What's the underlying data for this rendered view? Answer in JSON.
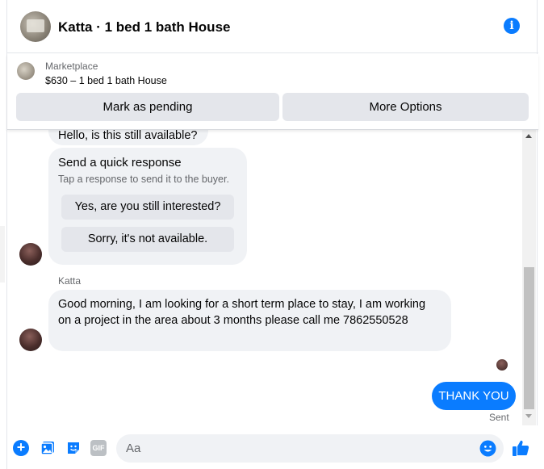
{
  "header": {
    "title": "Katta · 1 bed 1 bath House",
    "info_icon": "info-icon"
  },
  "marketplace": {
    "label": "Marketplace",
    "listing": "$630 – 1 bed 1 bath House",
    "buttons": {
      "pending": "Mark as pending",
      "more": "More Options"
    }
  },
  "messages": {
    "hello": "Hello, is this still available?",
    "quick_response": {
      "title": "Send a quick response",
      "subtitle": "Tap a response to send it to the buyer.",
      "options": [
        "Yes, are you still interested?",
        "Sorry, it's not available."
      ]
    },
    "sender_name": "Katta",
    "incoming": "Good morning,  I am looking for a short term place to stay,  I am working on a project in the area about 3 months please call me 7862550528",
    "outgoing": "THANK YOU",
    "status": "Sent"
  },
  "composer": {
    "placeholder": "Aa",
    "gif_label": "GIF"
  },
  "colors": {
    "accent": "#0a7cff",
    "bubble_gray": "#f0f2f5",
    "button_gray": "#e4e6eb"
  }
}
